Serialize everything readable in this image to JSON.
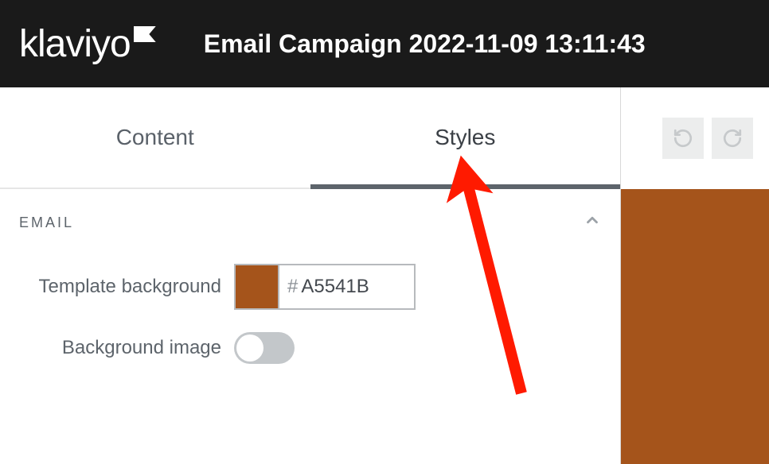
{
  "header": {
    "logo_text": "klaviyo",
    "campaign_title": "Email Campaign 2022-11-09 13:11:43"
  },
  "tabs": {
    "content": "Content",
    "styles": "Styles",
    "active": "styles"
  },
  "section": {
    "title": "EMAIL",
    "template_background_label": "Template background",
    "template_background_hex": "A5541B",
    "background_image_label": "Background image",
    "background_image_on": false
  },
  "colors": {
    "template_background": "#A5541B"
  }
}
